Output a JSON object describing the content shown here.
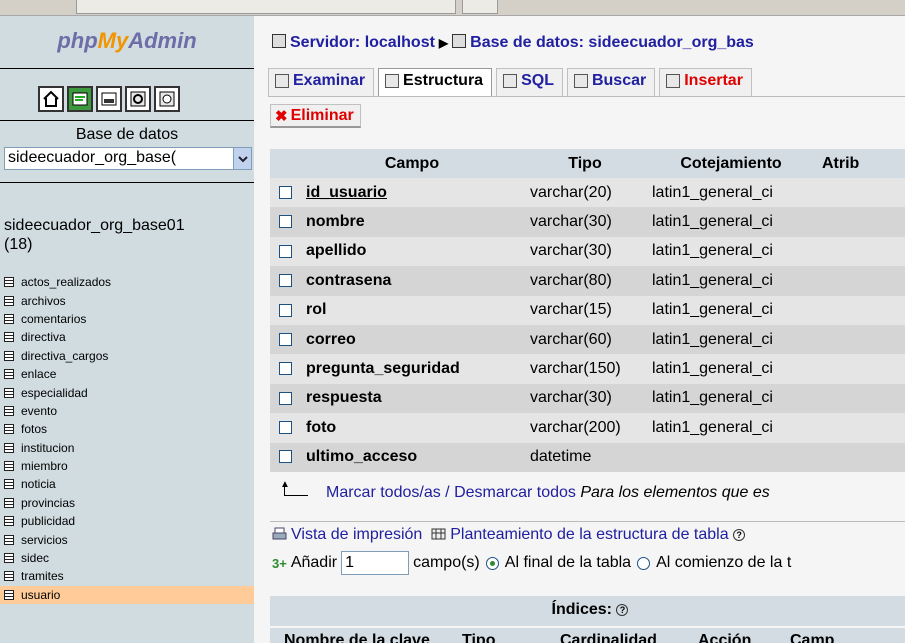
{
  "app": {
    "logo": {
      "php": "php",
      "my": "My",
      "admin": "Admin"
    }
  },
  "sidebar": {
    "icons": [
      "home-icon",
      "exit-icon",
      "sql-query-icon",
      "help-icon",
      "sql-docs-icon"
    ],
    "db_label": "Base de datos",
    "db_select_value": "sideecuador_org_base(",
    "db_name": "sideecuador_org_base01",
    "db_count": "(18)",
    "tables": [
      "actos_realizados",
      "archivos",
      "comentarios",
      "directiva",
      "directiva_cargos",
      "enlace",
      "especialidad",
      "evento",
      "fotos",
      "institucion",
      "miembro",
      "noticia",
      "provincias",
      "publicidad",
      "servicios",
      "sidec",
      "tramites",
      "usuario"
    ],
    "active_table": "usuario"
  },
  "breadcrumb": {
    "server": "Servidor: localhost",
    "database": "Base de datos: sideecuador_org_bas"
  },
  "tabs": [
    {
      "label": "Examinar",
      "icon": "browse-icon"
    },
    {
      "label": "Estructura",
      "icon": "structure-icon"
    },
    {
      "label": "SQL",
      "icon": "sql-icon"
    },
    {
      "label": "Buscar",
      "icon": "search-icon"
    },
    {
      "label": "Insertar",
      "icon": "insert-icon"
    }
  ],
  "delete_tab": {
    "label": "Eliminar",
    "icon": "delete-icon"
  },
  "structure": {
    "headers": [
      "Campo",
      "Tipo",
      "Cotejamiento",
      "Atrib"
    ],
    "rows": [
      {
        "campo": "id_usuario",
        "tipo": "varchar(20)",
        "cotejamiento": "latin1_general_ci"
      },
      {
        "campo": "nombre",
        "tipo": "varchar(30)",
        "cotejamiento": "latin1_general_ci"
      },
      {
        "campo": "apellido",
        "tipo": "varchar(30)",
        "cotejamiento": "latin1_general_ci"
      },
      {
        "campo": "contrasena",
        "tipo": "varchar(80)",
        "cotejamiento": "latin1_general_ci"
      },
      {
        "campo": "rol",
        "tipo": "varchar(15)",
        "cotejamiento": "latin1_general_ci"
      },
      {
        "campo": "correo",
        "tipo": "varchar(60)",
        "cotejamiento": "latin1_general_ci"
      },
      {
        "campo": "pregunta_seguridad",
        "tipo": "varchar(150)",
        "cotejamiento": "latin1_general_ci"
      },
      {
        "campo": "respuesta",
        "tipo": "varchar(30)",
        "cotejamiento": "latin1_general_ci"
      },
      {
        "campo": "foto",
        "tipo": "varchar(200)",
        "cotejamiento": "latin1_general_ci"
      },
      {
        "campo": "ultimo_acceso",
        "tipo": "datetime",
        "cotejamiento": ""
      }
    ]
  },
  "mark": {
    "mark_all": "Marcar todos/as",
    "separator": " / ",
    "unmark_all": "Desmarcar todos",
    "selected_text": "Para los elementos que es"
  },
  "links": {
    "print_view": "Vista de impresión",
    "propose_structure": "Planteamiento de la estructura de tabla"
  },
  "add_fields": {
    "label": "Añadir",
    "value": "1",
    "suffix": "campo(s)",
    "opt_end": "Al final de la tabla",
    "opt_begin": "Al comienzo de la t"
  },
  "indexes": {
    "title": "Índices:",
    "headers": [
      "Nombre de la clave",
      "Tipo",
      "Cardinalidad",
      "Acción",
      "Camp"
    ]
  }
}
